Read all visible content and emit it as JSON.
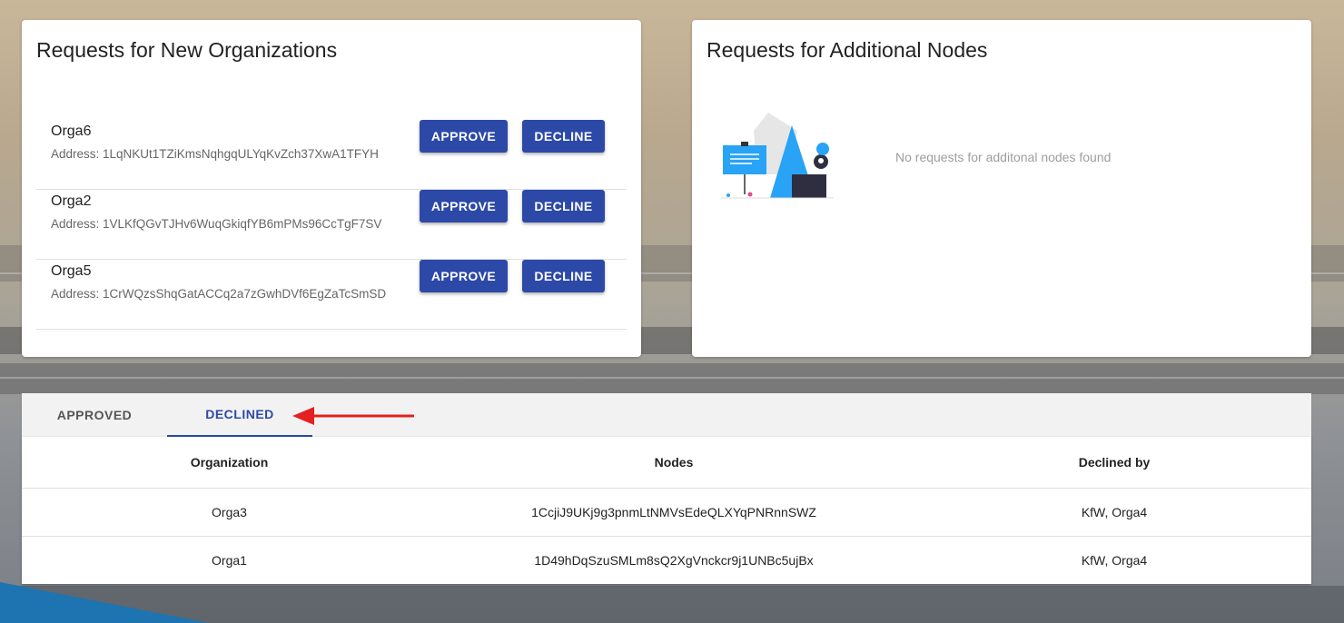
{
  "orgs_requests": {
    "title": "Requests for New Organizations",
    "address_prefix": "Address: ",
    "items": [
      {
        "name": "Orga6",
        "address": "Address: 1LqNKUt1TZiKmsNqhgqULYqKvZch37XwA1TFYH",
        "approve_label": "APPROVE",
        "decline_label": "DECLINE"
      },
      {
        "name": "Orga2",
        "address": "Address: 1VLKfQGvTJHv6WuqGkiqfYB6mPMs96CcTgF7SV",
        "approve_label": "APPROVE",
        "decline_label": "DECLINE"
      },
      {
        "name": "Orga5",
        "address": "Address: 1CrWQzsShqGatACCq2a7zGwhDVf6EgZaTcSmSD",
        "approve_label": "APPROVE",
        "decline_label": "DECLINE"
      }
    ]
  },
  "nodes_requests": {
    "title": "Requests for Additional Nodes",
    "empty_message": "No requests for additonal nodes found"
  },
  "tabs": {
    "items": [
      {
        "label": "APPROVED",
        "active": false
      },
      {
        "label": "DECLINED",
        "active": true
      }
    ]
  },
  "declined_table": {
    "headers": {
      "organization": "Organization",
      "nodes": "Nodes",
      "declined_by": "Declined by"
    },
    "rows": [
      {
        "organization": "Orga3",
        "nodes": "1CcjiJ9UKj9g3pnmLtNMVsEdeQLXYqPNRnnSWZ",
        "declined_by": "KfW, Orga4"
      },
      {
        "organization": "Orga1",
        "nodes": "1D49hDqSzuSMLm8sQ2XgVnckcr9j1UNBc5ujBx",
        "declined_by": "KfW, Orga4"
      }
    ]
  },
  "colors": {
    "primary": "#2c49a8",
    "annotation_arrow": "#e52020",
    "illustration_blue": "#29a3f5"
  },
  "icons": [
    "empty-state-illustration",
    "red-arrow-annotation"
  ]
}
